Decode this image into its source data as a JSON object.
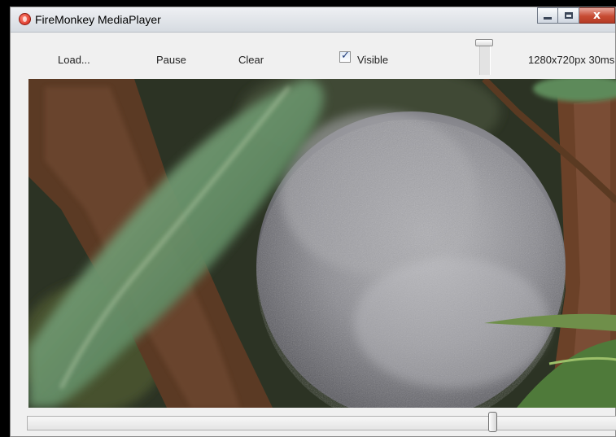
{
  "window": {
    "title": "FireMonkey MediaPlayer",
    "icon": "firemonkey-app-icon"
  },
  "titlebar_buttons": {
    "minimize": "minimize-icon",
    "maximize": "maximize-icon",
    "close_glyph": "x"
  },
  "toolbar": {
    "load_label": "Load...",
    "pause_label": "Pause",
    "clear_label": "Clear",
    "visible_label": "Visible",
    "visible_checked": true,
    "stats": "1280x720px 30ms"
  },
  "video": {
    "content": "koala sleeping in a tree"
  },
  "colors": {
    "close_button": "#c74b33",
    "window_bg": "#f0f0f0",
    "outer_bg": "#000000"
  }
}
